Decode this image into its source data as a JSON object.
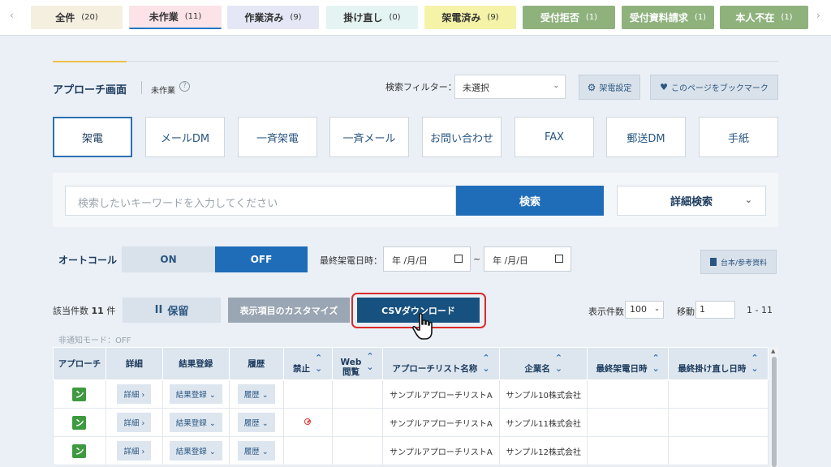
{
  "tabs": [
    {
      "label": "全件",
      "count": "(20)",
      "bg": "#f5efe0",
      "fg": "#333333"
    },
    {
      "label": "未作業",
      "count": "(11)",
      "bg": "#fbe3e8",
      "fg": "#333333"
    },
    {
      "label": "作業済み",
      "count": "(9)",
      "bg": "#e5e7f6",
      "fg": "#333333"
    },
    {
      "label": "掛け直し",
      "count": "(0)",
      "bg": "#e4f4f2",
      "fg": "#333333"
    },
    {
      "label": "架電済み",
      "count": "(9)",
      "bg": "#f4f3a8",
      "fg": "#333333"
    },
    {
      "label": "受付拒否",
      "count": "(1)",
      "bg": "#8fb27d",
      "fg": "#ffffff"
    },
    {
      "label": "受付資料請求",
      "count": "(1)",
      "bg": "#8fb27d",
      "fg": "#ffffff"
    },
    {
      "label": "本人不在",
      "count": "(1)",
      "bg": "#8fb27d",
      "fg": "#ffffff"
    }
  ],
  "tab_nav": {
    "prev": "‹",
    "next": "›"
  },
  "header": {
    "title": "アプローチ画面",
    "subtitle": "未作業",
    "help": "?",
    "filter_label": "検索フィルター：",
    "filter_value": "未選択",
    "call_settings": "架電設定",
    "bookmark": "このページをブックマーク"
  },
  "channels": [
    "架電",
    "メールDM",
    "一斉架電",
    "一斉メール",
    "お問い合わせ",
    "FAX",
    "郵送DM",
    "手紙"
  ],
  "search": {
    "placeholder": "検索したいキーワードを入力してください",
    "button": "検索",
    "advanced": "詳細検索"
  },
  "autocall": {
    "label": "オートコール",
    "on": "ON",
    "off": "OFF",
    "date_label": "最終架電日時：",
    "date_from": "年 /月/日",
    "date_to": "年 /月/日",
    "tilde": "~",
    "docs_button": "台本/参考資料"
  },
  "actions": {
    "count_prefix": "該当件数",
    "count_value": "11",
    "count_suffix": "件",
    "hold": "保留",
    "hold_icon": "II",
    "customize": "表示項目のカスタマイズ",
    "csv": "CSVダウンロード",
    "per_page_label": "表示件数",
    "per_page_value": "100",
    "move_label": "移動",
    "move_value": "1",
    "range": "1 - 11",
    "notify_mode": "非通知モード：OFF"
  },
  "table": {
    "headers": [
      "アプローチ",
      "詳細",
      "結果登録",
      "履歴",
      "禁止",
      "Web閲覧",
      "アプローチリスト名称",
      "企業名",
      "最終架電日時",
      "最終掛け直し日時"
    ],
    "web_line1": "Web",
    "web_line2": "閲覧",
    "rows": [
      {
        "call": "ン",
        "detail": "詳細",
        "result": "結果登録",
        "history": "履歴",
        "banned": false,
        "list": "サンプルアプローチリストA",
        "company": "サンプル10株式会社"
      },
      {
        "call": "ン",
        "detail": "詳細",
        "result": "結果登録",
        "history": "履歴",
        "banned": true,
        "list": "サンプルアプローチリストA",
        "company": "サンプル11株式会社"
      },
      {
        "call": "ン",
        "detail": "詳細",
        "result": "結果登録",
        "history": "履歴",
        "banned": false,
        "list": "サンプルアプローチリストA",
        "company": "サンプル12株式会社"
      }
    ]
  }
}
